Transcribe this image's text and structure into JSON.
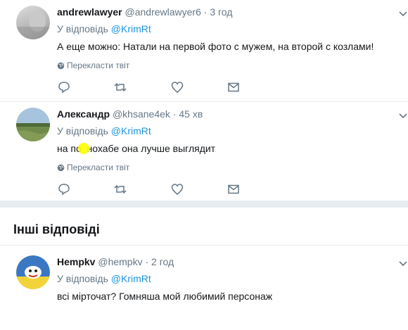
{
  "tweets": [
    {
      "name": "andrewlawyer",
      "handle": "@andrewlawyer6",
      "dot": "·",
      "time": "3 год",
      "reply_prefix": "У відповідь",
      "reply_mention": "@KrimRt",
      "text": "А еще можно: Натали на первой фото с мужем, на второй с козлами!",
      "translate": "Перекласти твіт"
    },
    {
      "name": "Александр",
      "handle": "@khsane4ek",
      "dot": "·",
      "time": "45 хв",
      "reply_prefix": "У відповідь",
      "reply_mention": "@KrimRt",
      "text": "на по  нохабе она лучше выглядит",
      "translate": "Перекласти твіт"
    },
    {
      "name": "Hempkv",
      "handle": "@hempkv",
      "dot": "·",
      "time": "2 год",
      "reply_prefix": "У відповідь",
      "reply_mention": "@KrimRt",
      "text": "всі мірточат? Гомняша мой любимий персонаж"
    }
  ],
  "section": {
    "title": "Інші відповіді"
  },
  "icons": {
    "reply": "reply-icon",
    "retweet": "retweet-icon",
    "like": "heart-icon",
    "dm": "envelope-icon",
    "globe": "globe-icon",
    "caret": "chevron-down-icon"
  },
  "colors": {
    "link": "#1b95e0",
    "secondary": "#657786",
    "text": "#14171a",
    "divider": "#e6ecf0"
  }
}
